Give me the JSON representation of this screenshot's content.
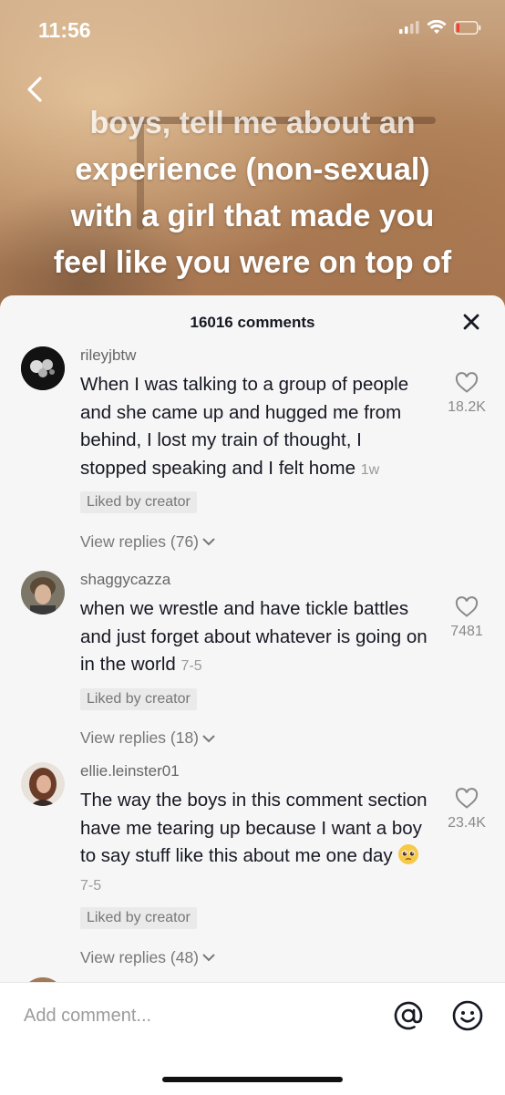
{
  "status_bar": {
    "time": "11:56"
  },
  "video": {
    "caption_lines": [
      "boys, tell me about an",
      "experience (non-sexual)",
      "with a girl that made you",
      "feel like you were on top of"
    ]
  },
  "comments_header": {
    "count_label": "16016 comments"
  },
  "comments": [
    {
      "username": "rileyjbtw",
      "text": "When I was talking to a group of people and she came up and hugged me from behind, I lost my train of thought, I stopped speaking and I felt home",
      "date": "1w",
      "liked_badge": "Liked by creator",
      "replies": "View replies (76)",
      "likes": "18.2K"
    },
    {
      "username": "shaggycazza",
      "text": "when we wrestle and have tickle battles and just forget about whatever is going on in the world",
      "date": "7-5",
      "liked_badge": "Liked by creator",
      "replies": "View replies (18)",
      "likes": "7481"
    },
    {
      "username": "ellie.leinster01",
      "text": "The way the boys in this comment section have me tearing up because I want a boy to say stuff like this about me one day",
      "emoji": "pleading-face",
      "date": "7-5",
      "liked_badge": "Liked by creator",
      "replies": "View replies (48)",
      "likes": "23.4K"
    }
  ],
  "comment_bar": {
    "placeholder": "Add comment..."
  },
  "icons": {
    "back": "chevron-left-icon",
    "close": "close-icon",
    "like": "heart-outline-icon",
    "mention": "at-icon",
    "emoji": "smiley-icon",
    "replies": "chevron-down-icon"
  },
  "colors": {
    "text": "#161823",
    "secondary": "#777777",
    "badge_bg": "#ebeaea",
    "battery_low": "#ff3b30"
  }
}
